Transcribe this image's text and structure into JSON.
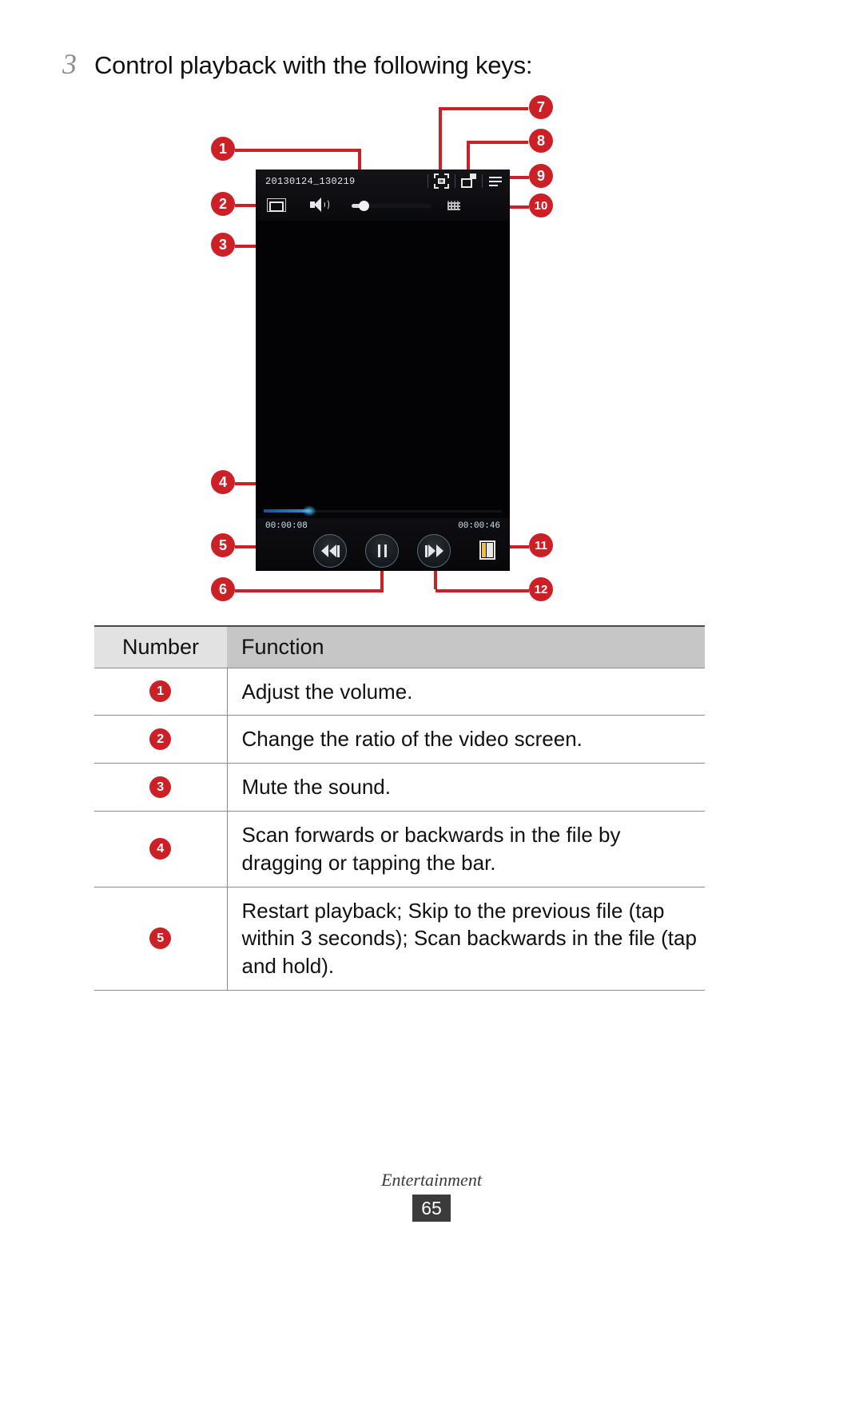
{
  "step": {
    "number": "3",
    "text": "Control playback with the following keys:"
  },
  "device": {
    "file_title": "20130124_130219",
    "time_current": "00:00:08",
    "time_total": "00:00:46",
    "icons": {
      "capture": "capture-frame-icon",
      "popup_play": "popup-play-icon",
      "menu": "hamburger-menu-icon",
      "ratio": "screen-ratio-icon",
      "speaker": "speaker-volume-icon",
      "equalizer": "equalizer-icon",
      "previous": "skip-previous-icon",
      "pause": "pause-icon",
      "next": "skip-next-icon",
      "bookmark": "bookmark-icon"
    }
  },
  "callouts": [
    {
      "id": "1",
      "label": "1"
    },
    {
      "id": "2",
      "label": "2"
    },
    {
      "id": "3",
      "label": "3"
    },
    {
      "id": "4",
      "label": "4"
    },
    {
      "id": "5",
      "label": "5"
    },
    {
      "id": "6",
      "label": "6"
    },
    {
      "id": "7",
      "label": "7"
    },
    {
      "id": "8",
      "label": "8"
    },
    {
      "id": "9",
      "label": "9"
    },
    {
      "id": "10",
      "label": "10"
    },
    {
      "id": "11",
      "label": "11"
    },
    {
      "id": "12",
      "label": "12"
    }
  ],
  "table": {
    "headers": {
      "number": "Number",
      "function": "Function"
    },
    "rows": [
      {
        "number": "1",
        "function": "Adjust the volume."
      },
      {
        "number": "2",
        "function": "Change the ratio of the video screen."
      },
      {
        "number": "3",
        "function": "Mute the sound."
      },
      {
        "number": "4",
        "function": "Scan forwards or backwards in the file by dragging or tapping the bar."
      },
      {
        "number": "5",
        "function": "Restart playback; Skip to the previous file (tap within 3 seconds); Scan backwards in the file (tap and hold)."
      }
    ]
  },
  "footer": {
    "section": "Entertainment",
    "page": "65"
  },
  "colors": {
    "callout_red": "#cc2027",
    "table_header": "#c6c6c6",
    "page_badge": "#3b3b3b"
  }
}
